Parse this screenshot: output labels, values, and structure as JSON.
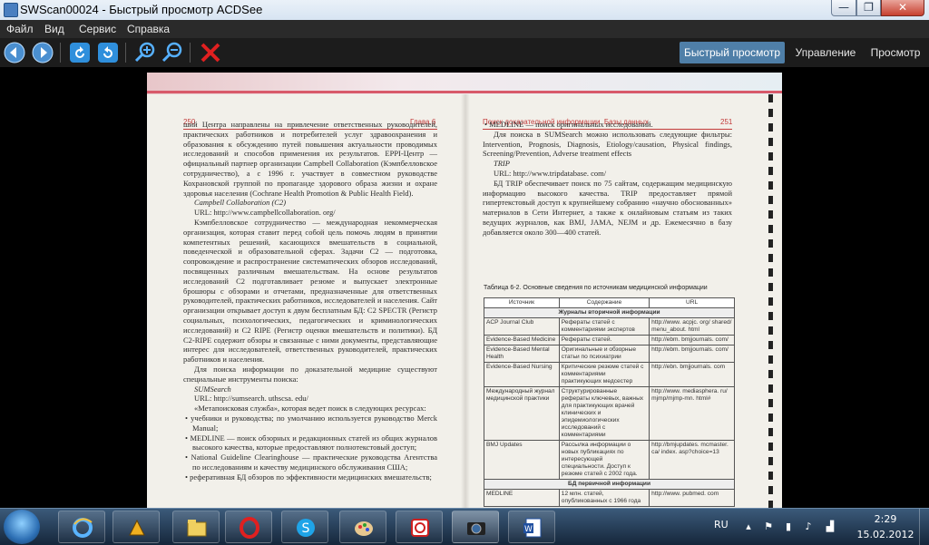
{
  "window": {
    "title": "SWScan00024 - Быстрый просмотр ACDSee",
    "min_glyph": "—",
    "max_glyph": "❐",
    "close_glyph": "✕"
  },
  "menu": [
    "Файл",
    "Вид",
    "Сервис",
    "Справка"
  ],
  "toolbar": {
    "icons": [
      "back-arrow-icon",
      "forward-arrow-icon",
      "rotate-left-icon",
      "rotate-right-icon",
      "zoom-in-icon",
      "zoom-out-icon",
      "close-red-x-icon"
    ],
    "modes": {
      "quickview": "Быстрый просмотр",
      "manage": "Управление",
      "view": "Просмотр"
    },
    "accent": "#4f7fa8"
  },
  "scan": {
    "left_header_num": "250",
    "left_header_chapter": "Глава 6",
    "right_header_title": "Поиск доказательной информации. Базы данных",
    "right_header_num": "251",
    "left_paragraphs": [
      "ший Центра направлены на привлечение ответственных руководителей, практических работников и потребителей услуг здравоохранения и образования к обсуждению путей повышения актуальности проводимых исследований и способов применения их результатов. EPPI-Центр — официальный партнер организации Campbell Collaboration (Кэмпбелловское сотрудничество), а с 1996 г. участвует в совместном руководстве Кохрановской группой по пропаганде здорового образа жизни и охране здоровья населения (Cochrane Health Promotion & Public Health Field).",
      "Campbell Collaboration (C2)",
      "URL: http://www.campbellcollaboration. org/",
      "Кэмпбелловское сотрудничество — международная некоммерческая организация, которая ставит перед собой цель помочь людям в принятии компетентных решений, касающихся вмешательств в социальной, поведенческой и образовательной сферах. Задачи C2 — подготовка, сопровождение и распространение систематических обзоров исследований, посвященных различным вмешательствам. На основе результатов исследований C2 подготавливает резюме и выпускает электронные брошюры с обзорами и отчетами, предназначенные для ответственных руководителей, практических работников, исследователей и населения. Сайт организации открывает доступ к двум бесплатным БД: C2 SPECTR (Регистр социальных, психологических, педагогических и криминологических исследований) и C2 RIPE (Регистр оценки вмешательств и политики). БД C2-RIPE содержит обзоры и связанные с ними документы, представляющие интерес для исследователей, ответственных руководителей, практических работников и населения.",
      "Для поиска информации по доказательной медицине существуют специальные инструменты поиска:",
      "SUMSearch",
      "URL: http://sumsearch. uthscsa. edu/",
      "«Метапоисковая служба», которая ведет поиск в следующих ресурсах:",
      "• учебники и руководства; по умолчанию используется руководство Merck Manual;",
      "• MEDLINE — поиск обзорных и редакционных статей из общих журналов высокого качества, которые предоставляют полнотекстовый доступ;",
      "• National Guideline Clearinghouse — практические руководства Агентства по исследованиям и качеству медицинского обслуживания США;",
      "• реферативная БД обзоров по эффективности медицинских вмешательств;"
    ],
    "right_paragraphs": [
      "• MEDLINE — поиск оригинальных исследований.",
      "Для поиска в SUMSearch можно использовать следующие фильтры: Intervention, Prognosis, Diagnosis, Etiology/causation, Physical findings, Screening/Prevention, Adverse treatment effects",
      "TRIP",
      "URL: http://www.tripdatabase. com/",
      "БД TRIP обеспечивает поиск по 75 сайтам, содержащим медицинскую информацию высокого качества. TRIP предоставляет прямой гипертекстовый доступ к крупнейшему собранию «научно обоснованных» материалов в Сети Интернет, а также к онлайновым статьям из таких ведущих журналов, как BMJ, JAMA, NEJM и др. Ежемесячно в базу добавляется около 300—400 статей."
    ],
    "table_caption": "Таблица 6-2. Основные сведения по источникам медицинской информации",
    "table_headers": [
      "Источник",
      "Содержание",
      "URL"
    ],
    "table_group1": "Журналы вторичной информации",
    "table_rows1": [
      [
        "ACP Journal Club",
        "Рефераты статей с комментариями экспертов",
        "http://www. acpjc. org/ shared/ menu_about. html"
      ],
      [
        "Evidence-Based Medicine",
        "Рефераты статей.",
        "http://ebm. bmjjournals. com/"
      ],
      [
        "Evidence-Based Mental Health",
        "Оригинальные и обзорные статьи по психиатрии",
        "http://ebm. bmjjournals. com/"
      ],
      [
        "Evidence-Based Nursing",
        "Критические резюме статей с комментариями практикующих медсестер",
        "http://ebn. bmjjournals. com"
      ],
      [
        "Международный журнал медицинской практики",
        "Структурированные рефераты ключевых, важных для практикующих врачей клинических и эпидемиологических исследований с комментариями",
        "http://www. mediasphera. ru/ mjmp/mjmp-mn. html#"
      ],
      [
        "BMJ Updates",
        "Рассылка информации о новых публикациях по интересующей специальности. Доступ к резюме статей с 2002 года.",
        "http://bmjupdates. mcmaster. ca/ index. asp?choice=13"
      ]
    ],
    "table_group2": "БД первичной информации",
    "table_rows2": [
      [
        "MEDLINE",
        "12 млн. статей, опубликованных с 1966 года",
        "http://www. pubmed. com"
      ]
    ]
  },
  "taskbar": {
    "apps": [
      "internet-explorer-icon",
      "winamp-icon",
      "file-manager-icon",
      "opera-icon",
      "skype-icon",
      "paint-icon",
      "foxit-reader-icon",
      "acdsee-icon",
      "word-icon"
    ],
    "lang": "RU",
    "time": "2:29",
    "date": "15.02.2012"
  }
}
